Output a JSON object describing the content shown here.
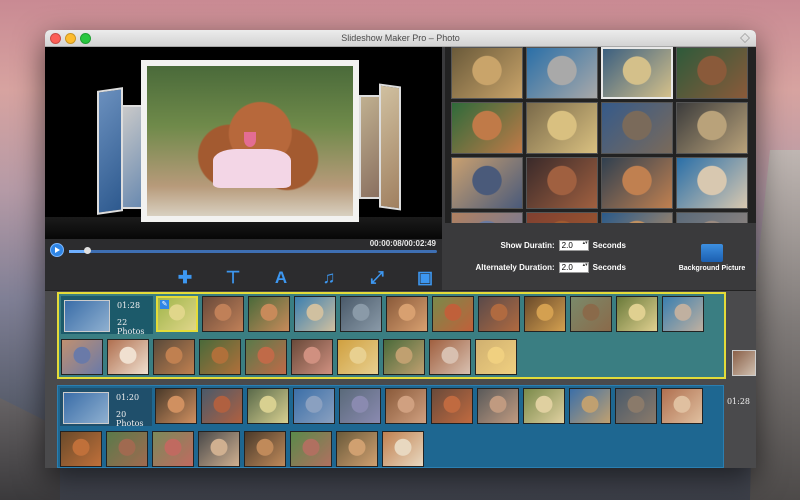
{
  "window": {
    "title": "Slideshow Maker Pro – Photo"
  },
  "preview": {
    "time": "00:00:08/00:02:49",
    "progress": 0.05
  },
  "toolbar": {
    "add_icon": "plus-icon",
    "transition_icon": "transition-icon",
    "text_icon": "text-icon",
    "music_icon": "music-icon",
    "fullscreen_icon": "fullscreen-icon",
    "save_icon": "save-icon"
  },
  "settings": {
    "show_duration_label": "Show Duratin:",
    "show_duration_value": "2.0",
    "show_duration_unit": "Seconds",
    "alt_duration_label": "Alternately Duration:",
    "alt_duration_value": "2.0",
    "alt_duration_unit": "Seconds",
    "background_picture_label": "Background Picture"
  },
  "colors": {
    "accent": "#3d97f0",
    "selected_group_border": "#e4dc39",
    "group1_bg": "#3a7e82",
    "group2_bg": "#1e6791"
  },
  "library_thumbs": [
    {
      "c1": "#c9a46a",
      "c2": "#6a5a3a"
    },
    {
      "c1": "#a9a9a9",
      "c2": "#2a6fa8"
    },
    {
      "c1": "#d4c08a",
      "c2": "#3b5f80"
    },
    {
      "c1": "#8a5a3a",
      "c2": "#2e5a3a"
    },
    {
      "c1": "#c07a48",
      "c2": "#2e6a3a"
    },
    {
      "c1": "#d9c080",
      "c2": "#7a6a4a"
    },
    {
      "c1": "#7a6a5a",
      "c2": "#355a8a"
    },
    {
      "c1": "#b9a27a",
      "c2": "#3c3c3c"
    },
    {
      "c1": "#4a5a7a",
      "c2": "#c9a070"
    },
    {
      "c1": "#a06040",
      "c2": "#3a2a2a"
    },
    {
      "c1": "#c08050",
      "c2": "#304050"
    },
    {
      "c1": "#d8c8b0",
      "c2": "#2a6fa8"
    },
    {
      "c1": "#6a7aa0",
      "c2": "#b08060"
    },
    {
      "c1": "#a05a30",
      "c2": "#804030"
    },
    {
      "c1": "#c09060",
      "c2": "#2a5a8a"
    },
    {
      "c1": "#9a8a80",
      "c2": "#5a6a7a"
    }
  ],
  "groups": [
    {
      "duration": "01:28",
      "count": "22 Photos",
      "side_duration": "01:28",
      "row1": [
        {
          "c1": "#e0d68a",
          "c2": "#9fb54a",
          "sel": true
        },
        {
          "c1": "#c08058",
          "c2": "#6a4a3a"
        },
        {
          "c1": "#c88a5a",
          "c2": "#4a6a3a"
        },
        {
          "c1": "#d0c0a0",
          "c2": "#3b7fb0"
        },
        {
          "c1": "#8a9aa8",
          "c2": "#4a5a6a"
        },
        {
          "c1": "#d8a070",
          "c2": "#8a5a3a"
        },
        {
          "c1": "#c0603a",
          "c2": "#7a8a4a"
        },
        {
          "c1": "#b06a40",
          "c2": "#5a4a4a"
        },
        {
          "c1": "#d4a050",
          "c2": "#6a4a2a"
        },
        {
          "c1": "#8a6a4a",
          "c2": "#7a8a6a"
        },
        {
          "c1": "#e0d090",
          "c2": "#6a7a3a"
        },
        {
          "c1": "#c0b0a0",
          "c2": "#3a7fb0"
        }
      ],
      "row2": [
        {
          "c1": "#6a7aa8",
          "c2": "#c09070"
        },
        {
          "c1": "#f0e0d0",
          "c2": "#b07050"
        },
        {
          "c1": "#c08050",
          "c2": "#5a4a3a"
        },
        {
          "c1": "#b0703a",
          "c2": "#4a6a3a"
        },
        {
          "c1": "#c06a48",
          "c2": "#5a7a4a"
        },
        {
          "c1": "#d09080",
          "c2": "#6a4a3a"
        },
        {
          "c1": "#e8d090",
          "c2": "#d0a040"
        },
        {
          "c1": "#c0a070",
          "c2": "#4a6a3a"
        },
        {
          "c1": "#d8c0b0",
          "c2": "#a06040"
        },
        {
          "c1": "#f0d080",
          "c2": "#d0b070"
        }
      ]
    },
    {
      "duration": "01:20",
      "count": "20 Photos",
      "row1": [
        {
          "c1": "#d09060",
          "c2": "#4a3a2a"
        },
        {
          "c1": "#b06040",
          "c2": "#4a5a6a"
        },
        {
          "c1": "#d8d090",
          "c2": "#5a6a4a"
        },
        {
          "c1": "#8aa0c0",
          "c2": "#3b6fa8"
        },
        {
          "c1": "#8a8ab0",
          "c2": "#5a6a7a"
        },
        {
          "c1": "#d0a080",
          "c2": "#8a5a3a"
        },
        {
          "c1": "#c06a40",
          "c2": "#6a4a3a"
        },
        {
          "c1": "#c09a80",
          "c2": "#5a5a5a"
        },
        {
          "c1": "#e0d0a0",
          "c2": "#7a8a4a"
        },
        {
          "c1": "#c0a070",
          "c2": "#3b6fa8"
        },
        {
          "c1": "#8a7a6a",
          "c2": "#4a5a6a"
        },
        {
          "c1": "#e0c0a0",
          "c2": "#b07050"
        }
      ],
      "row2": [
        {
          "c1": "#c0703a",
          "c2": "#6a4a2a"
        },
        {
          "c1": "#a06a50",
          "c2": "#5a7a4a"
        },
        {
          "c1": "#c06a60",
          "c2": "#7a8a5a"
        },
        {
          "c1": "#d0b090",
          "c2": "#4a4a4a"
        },
        {
          "c1": "#c08a5a",
          "c2": "#4a3a2a"
        },
        {
          "c1": "#b07060",
          "c2": "#5a8a4a"
        },
        {
          "c1": "#d0a070",
          "c2": "#6a5a3a"
        },
        {
          "c1": "#e8d8c0",
          "c2": "#c08050"
        }
      ]
    }
  ]
}
